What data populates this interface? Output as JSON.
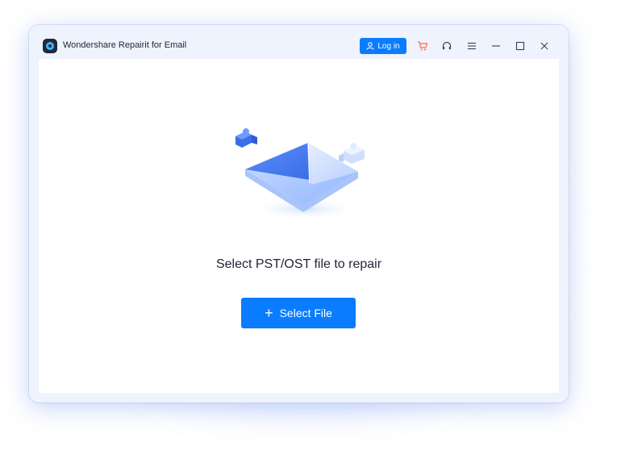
{
  "app": {
    "title": "Wondershare Repairit for Email"
  },
  "titlebar": {
    "login_label": "Log in",
    "icons": [
      "cart-icon",
      "headset-icon",
      "menu-icon",
      "minimize-icon",
      "maximize-icon",
      "close-icon"
    ]
  },
  "main": {
    "headline": "Select PST/OST file to repair",
    "select_button_label": "Select File",
    "select_button_icon": "+"
  },
  "colors": {
    "accent": "#0a7cff",
    "cart": "#ff6a3d",
    "window_bg": "#eef3fd",
    "text": "#1e2433"
  }
}
